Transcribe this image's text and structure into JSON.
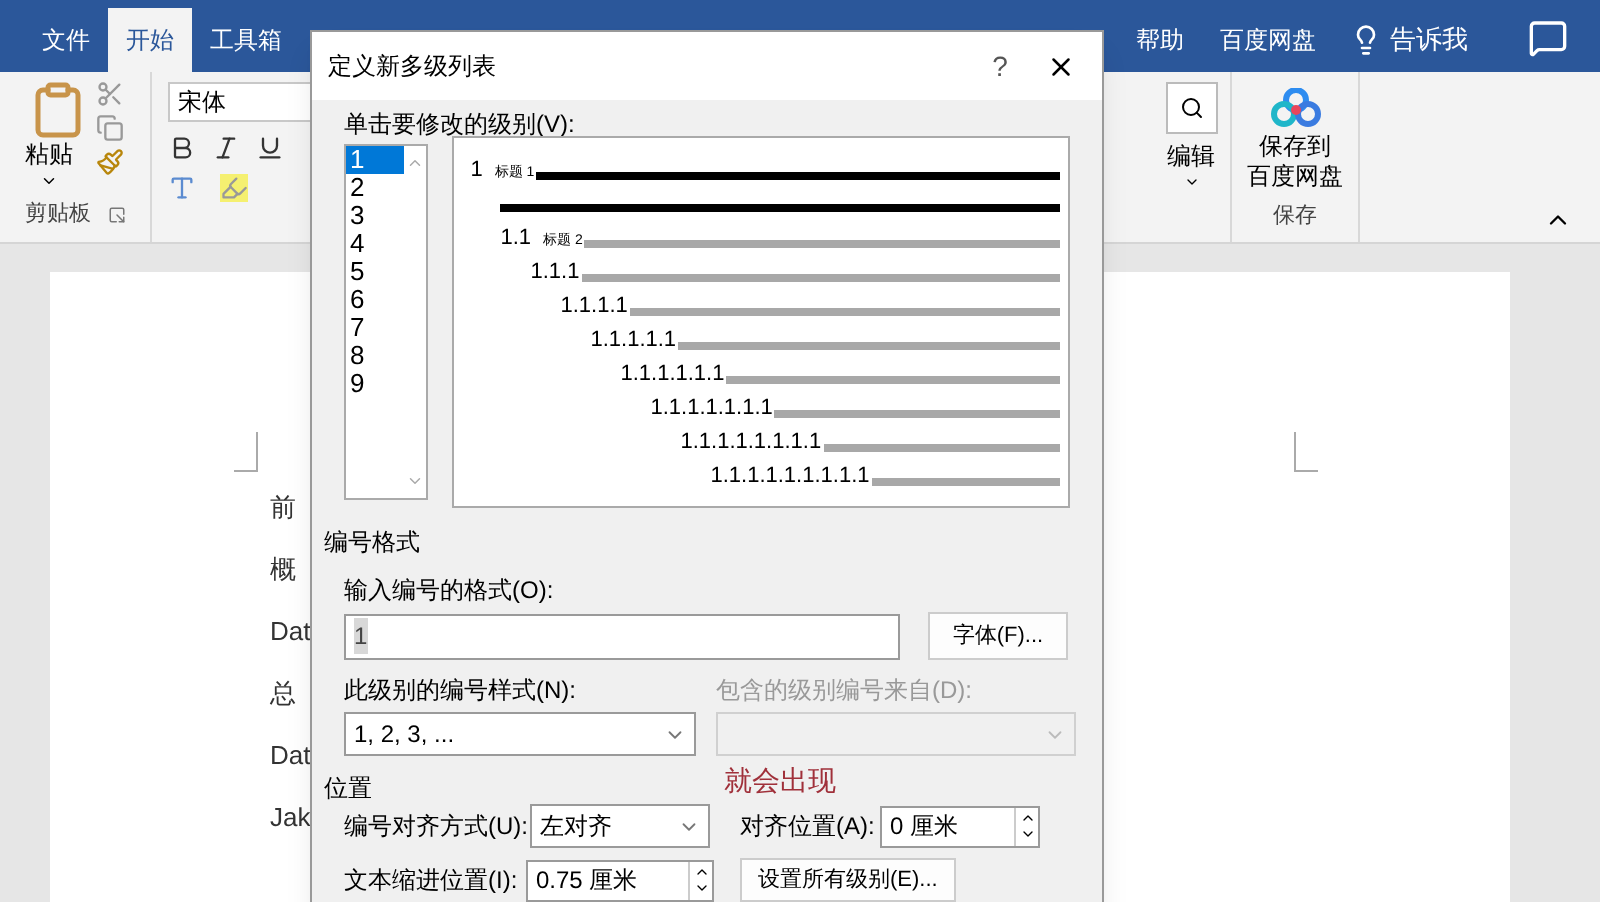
{
  "tabs": [
    {
      "label": "文件",
      "selected": false
    },
    {
      "label": "开始",
      "selected": true
    },
    {
      "label": "工具箱",
      "selected": false
    }
  ],
  "right_tabs": [
    {
      "label": "帮助",
      "selected": false
    },
    {
      "label": "百度网盘",
      "selected": false
    }
  ],
  "tell_me": "告诉我",
  "ribbon": {
    "paste": "粘贴",
    "clipboard_group": "剪贴板",
    "font_name": "宋体",
    "editing": "编辑",
    "save_button": [
      "保存到",
      "百度网盘"
    ],
    "save_group": "保存"
  },
  "document": {
    "lines": [
      "前",
      "概",
      "Dat",
      "总",
      "Dat",
      "Jak"
    ]
  },
  "dialog": {
    "title": "定义新多级列表",
    "help": "?",
    "level_label": "单击要修改的级别(V):",
    "levels": [
      {
        "label": "1",
        "selected": true
      },
      {
        "label": "2",
        "selected": false
      },
      {
        "label": "3",
        "selected": false
      },
      {
        "label": "4",
        "selected": false
      },
      {
        "label": "5",
        "selected": false
      },
      {
        "label": "6",
        "selected": false
      },
      {
        "label": "7",
        "selected": false
      },
      {
        "label": "8",
        "selected": false
      },
      {
        "label": "9",
        "selected": false
      }
    ],
    "preview": [
      {
        "number": "1",
        "caption": "标题 1"
      },
      {
        "number": "1.1",
        "caption": "标题 2"
      },
      {
        "number": "1.1.1"
      },
      {
        "number": "1.1.1.1"
      },
      {
        "number": "1.1.1.1.1"
      },
      {
        "number": "1.1.1.1.1.1"
      },
      {
        "number": "1.1.1.1.1.1.1"
      },
      {
        "number": "1.1.1.1.1.1.1.1"
      },
      {
        "number": "1.1.1.1.1.1.1.1.1"
      }
    ],
    "number_format": {
      "heading": "编号格式",
      "format_label": "输入编号的格式(O):",
      "format_value": "1",
      "font_button": "字体(F)...",
      "style_label": "此级别的编号样式(N):",
      "style_value": "1, 2, 3, ...",
      "include_label": "包含的级别编号来自(D):",
      "include_disabled": true
    },
    "position": {
      "heading": "位置",
      "align_label": "编号对齐方式(U):",
      "align_value": "左对齐",
      "at_label": "对齐位置(A):",
      "at_value": "0 厘米",
      "indent_label": "文本缩进位置(I):",
      "indent_value": "0.75 厘米",
      "set_all_button": "设置所有级别(E)..."
    },
    "annotation": "就会出现"
  }
}
